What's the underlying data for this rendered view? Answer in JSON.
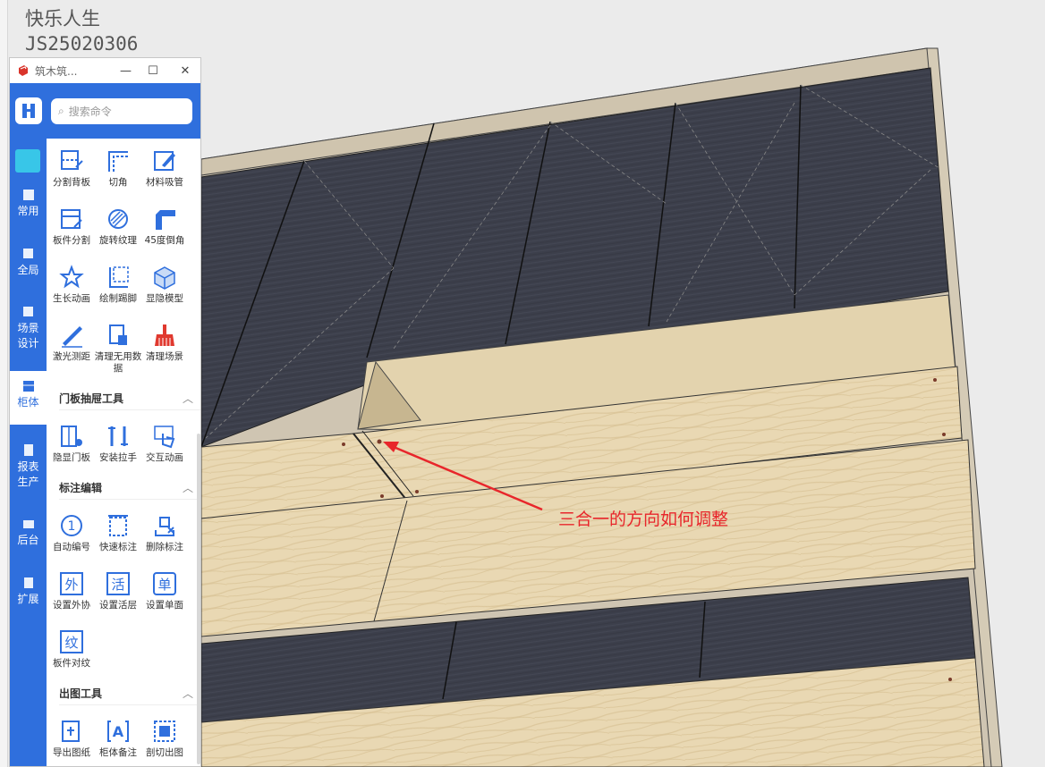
{
  "overlay": {
    "line1": "快乐人生",
    "line2": "JS25020306"
  },
  "annotation": {
    "text": "三合一的方向如何调整",
    "color": "#e8262b"
  },
  "window": {
    "title": "筑木筑..."
  },
  "search": {
    "placeholder": "搜索命令"
  },
  "sidebar": {
    "items": [
      {
        "label": "常用",
        "icon": "star-icon"
      },
      {
        "label": "全局",
        "icon": "globe-icon"
      },
      {
        "label": "场景\n设计",
        "icon": "scene-icon"
      },
      {
        "label": "柜体",
        "icon": "cabinet-icon",
        "active": true
      },
      {
        "label": "报表\n生产",
        "icon": "report-icon"
      },
      {
        "label": "后台",
        "icon": "backend-icon"
      },
      {
        "label": "扩展",
        "icon": "extend-icon"
      }
    ]
  },
  "tools": {
    "t1": "分割背板",
    "t2": "切角",
    "t3": "材料吸管",
    "t4": "板件分割",
    "t5": "旋转纹理",
    "t6": "45度倒角",
    "t7": "生长动画",
    "t8": "绘制踢脚",
    "t9": "显隐模型",
    "t10": "激光测距",
    "t11": "清理无用数据",
    "t12": "清理场景",
    "t13": "隐显门板",
    "t14": "安装拉手",
    "t15": "交互动画",
    "t16": "自动编号",
    "t17": "快速标注",
    "t18": "删除标注",
    "t19": "设置外协",
    "t20": "设置活层",
    "t21": "设置单面",
    "t22": "板件对纹",
    "t23": "导出图纸",
    "t24": "柜体备注",
    "t25": "剖切出图"
  },
  "glyphs": {
    "g19": "外",
    "g20": "活",
    "g21": "单",
    "g22": "纹",
    "g24": "A"
  },
  "sections": {
    "s1": "门板抽屉工具",
    "s2": "标注编辑",
    "s3": "出图工具"
  },
  "colors": {
    "accent": "#2f6fdd",
    "tool_icon": "#2f6fdd",
    "clean_icon": "#e0392f",
    "dark_panel": "#3b3d48",
    "wood": "#e8d6b0"
  }
}
